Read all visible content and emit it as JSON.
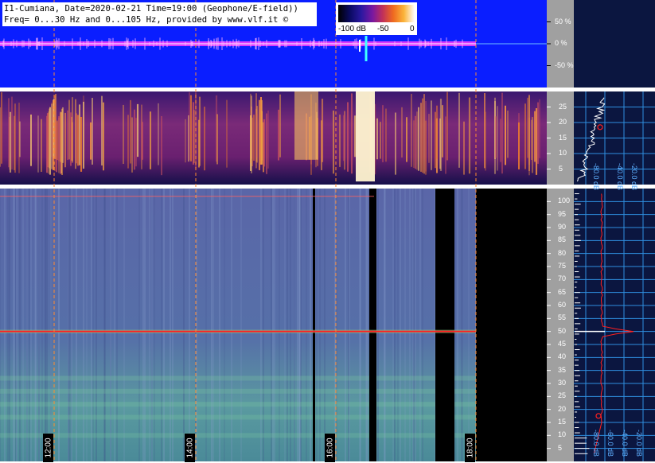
{
  "header": {
    "line1": "I1-Cumiana, Date=2020-02-21 Time=19:00 (Geophone/E-field))",
    "line2": "Freq= 0...30 Hz and 0...105 Hz, provided by www.vlf.it ©"
  },
  "colorbar": {
    "ticks": [
      "-100 dB",
      "-50",
      "0"
    ]
  },
  "colors": {
    "background": "#ffffff",
    "top_panel_blue": "#0a1eff",
    "trace_magenta": "#ff40ff",
    "side_panel_navy": "#0b1640",
    "side_grid": "#2f8fe0",
    "profile_red": "#ff2020",
    "marker_orange": "#ff8a30",
    "gray_axis": "#a0a0a0"
  },
  "chart_data": [
    {
      "type": "line",
      "panel": "amplitude",
      "y_ticks": [
        "50 %",
        "0 %",
        "-50 %"
      ],
      "ylim": [
        -100,
        100
      ]
    },
    {
      "type": "heatmap",
      "panel": "spectrogram-0-30Hz",
      "ylim": [
        0,
        30
      ],
      "y_ticks": [
        5,
        10,
        15,
        20,
        25
      ],
      "side_x_ticks": [
        "-80.0 dB",
        "-40.0 dB",
        "-20.0 dB"
      ]
    },
    {
      "type": "heatmap",
      "panel": "spectrogram-0-105Hz",
      "ylim": [
        0,
        105
      ],
      "y_ticks": [
        5,
        10,
        15,
        20,
        25,
        30,
        35,
        40,
        45,
        50,
        55,
        60,
        65,
        70,
        75,
        80,
        85,
        90,
        95,
        100
      ],
      "x_ticks": [
        "12:00",
        "14:00",
        "16:00",
        "18:00"
      ],
      "side_x_ticks": [
        "-80.0 dB",
        "-60.0 dB",
        "-40.0 dB",
        "-20.0 dB"
      ],
      "dominant_line_hz": 50
    }
  ]
}
